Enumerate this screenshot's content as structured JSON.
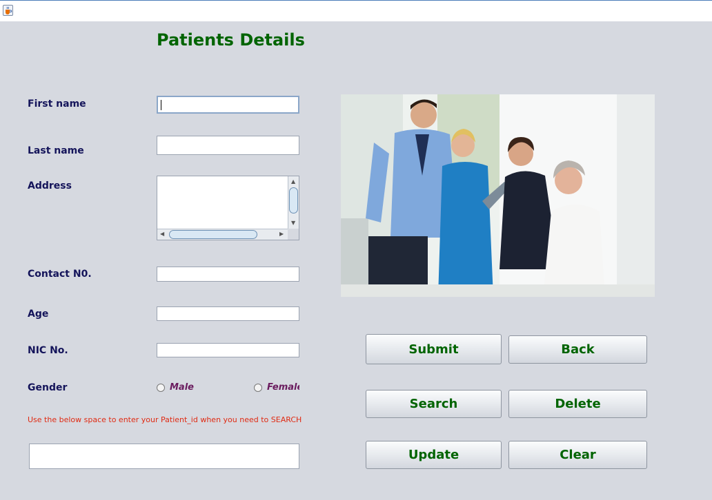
{
  "window": {
    "title": "",
    "icon": "java-coffee-icon"
  },
  "page": {
    "title": "Patients Details"
  },
  "form": {
    "first_name_label": "First name",
    "last_name_label": "Last name",
    "address_label": "Address",
    "contact_label": "Contact N0.",
    "age_label": "Age",
    "nic_label": "NIC No.",
    "gender_label": "Gender",
    "first_name_value": "",
    "last_name_value": "",
    "address_value": "",
    "contact_value": "",
    "age_value": "",
    "nic_value": "",
    "gender_options": {
      "male": "Male",
      "female": "Female"
    }
  },
  "search": {
    "hint": "Use the below space to enter your Patient_id when you need to SEARCH",
    "patient_id_value": ""
  },
  "buttons": {
    "submit": "Submit",
    "back": "Back",
    "search": "Search",
    "delete": "Delete",
    "update": "Update",
    "clear": "Clear"
  },
  "colors": {
    "background": "#d6d9e0",
    "title_green": "#006400",
    "label_navy": "#14145a",
    "hint_red": "#e02a12",
    "radio_purple": "#6a1b5e"
  }
}
